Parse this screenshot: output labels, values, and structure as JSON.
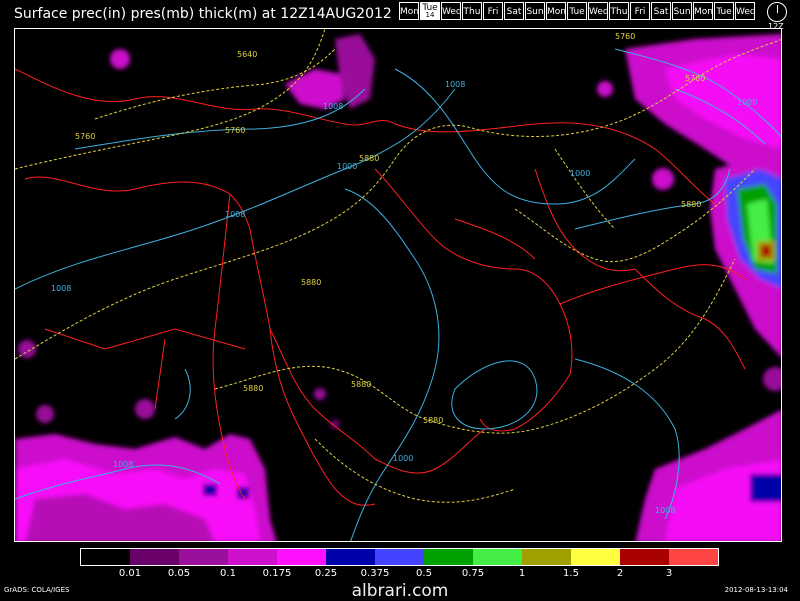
{
  "title": "Surface prec(in) pres(mb) thick(m) at 12Z14AUG2012",
  "days": [
    {
      "label": "Mon",
      "selected": false,
      "num": ""
    },
    {
      "label": "Tue",
      "selected": true,
      "num": "14"
    },
    {
      "label": "Wed",
      "selected": false,
      "num": ""
    },
    {
      "label": "Thu",
      "selected": false,
      "num": ""
    },
    {
      "label": "Fri",
      "selected": false,
      "num": ""
    },
    {
      "label": "Sat",
      "selected": false,
      "num": ""
    },
    {
      "label": "Sun",
      "selected": false,
      "num": ""
    },
    {
      "label": "Mon",
      "selected": false,
      "num": ""
    },
    {
      "label": "Tue",
      "selected": false,
      "num": ""
    },
    {
      "label": "Wed",
      "selected": false,
      "num": ""
    },
    {
      "label": "Thu",
      "selected": false,
      "num": ""
    },
    {
      "label": "Fri",
      "selected": false,
      "num": ""
    },
    {
      "label": "Sat",
      "selected": false,
      "num": ""
    },
    {
      "label": "Sun",
      "selected": false,
      "num": ""
    },
    {
      "label": "Mon",
      "selected": false,
      "num": ""
    },
    {
      "label": "Tue",
      "selected": false,
      "num": ""
    },
    {
      "label": "Wed",
      "selected": false,
      "num": ""
    }
  ],
  "clock_label": "12Z",
  "legend": {
    "colors": [
      "#000000",
      "#6a006a",
      "#9a109a",
      "#cc10cc",
      "#ff10ff",
      "#0000aa",
      "#4444ff",
      "#00a000",
      "#44ee44",
      "#a0a000",
      "#ffff40",
      "#aa0000",
      "#ff4444"
    ],
    "ticks": [
      "0.01",
      "0.05",
      "0.1",
      "0.175",
      "0.25",
      "0.375",
      "0.5",
      "0.75",
      "1",
      "1.5",
      "2",
      "3"
    ]
  },
  "contour_labels": {
    "pressure": [
      "1008",
      "1008",
      "1008",
      "1008",
      "1000",
      "1000",
      "1008",
      "1000",
      "1008",
      "1000"
    ],
    "thickness": [
      "5640",
      "5760",
      "5760",
      "5880",
      "5880",
      "5880",
      "5880",
      "5880",
      "5880",
      "5760",
      "5760"
    ]
  },
  "colors": {
    "pressure": "#40b0e0",
    "thickness": "#e0d040",
    "borders": "#ff2020"
  },
  "footer": {
    "left": "GrADS: COLA/IGES",
    "center": "albrari.com",
    "right": "2012-08-13-13:04"
  }
}
